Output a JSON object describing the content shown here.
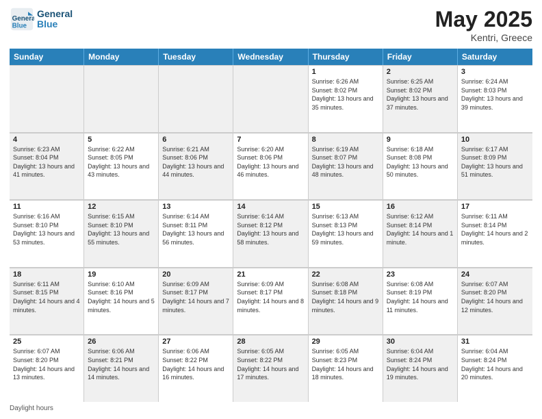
{
  "header": {
    "logo_general": "General",
    "logo_blue": "Blue",
    "month_title": "May 2025",
    "location": "Kentri, Greece"
  },
  "days_of_week": [
    "Sunday",
    "Monday",
    "Tuesday",
    "Wednesday",
    "Thursday",
    "Friday",
    "Saturday"
  ],
  "weeks": [
    [
      {
        "day": "",
        "info": "",
        "shaded": true
      },
      {
        "day": "",
        "info": "",
        "shaded": true
      },
      {
        "day": "",
        "info": "",
        "shaded": true
      },
      {
        "day": "",
        "info": "",
        "shaded": true
      },
      {
        "day": "1",
        "info": "Sunrise: 6:26 AM\nSunset: 8:02 PM\nDaylight: 13 hours and 35 minutes."
      },
      {
        "day": "2",
        "info": "Sunrise: 6:25 AM\nSunset: 8:02 PM\nDaylight: 13 hours and 37 minutes.",
        "shaded": true
      },
      {
        "day": "3",
        "info": "Sunrise: 6:24 AM\nSunset: 8:03 PM\nDaylight: 13 hours and 39 minutes."
      }
    ],
    [
      {
        "day": "4",
        "info": "Sunrise: 6:23 AM\nSunset: 8:04 PM\nDaylight: 13 hours and 41 minutes.",
        "shaded": true
      },
      {
        "day": "5",
        "info": "Sunrise: 6:22 AM\nSunset: 8:05 PM\nDaylight: 13 hours and 43 minutes."
      },
      {
        "day": "6",
        "info": "Sunrise: 6:21 AM\nSunset: 8:06 PM\nDaylight: 13 hours and 44 minutes.",
        "shaded": true
      },
      {
        "day": "7",
        "info": "Sunrise: 6:20 AM\nSunset: 8:06 PM\nDaylight: 13 hours and 46 minutes."
      },
      {
        "day": "8",
        "info": "Sunrise: 6:19 AM\nSunset: 8:07 PM\nDaylight: 13 hours and 48 minutes.",
        "shaded": true
      },
      {
        "day": "9",
        "info": "Sunrise: 6:18 AM\nSunset: 8:08 PM\nDaylight: 13 hours and 50 minutes."
      },
      {
        "day": "10",
        "info": "Sunrise: 6:17 AM\nSunset: 8:09 PM\nDaylight: 13 hours and 51 minutes.",
        "shaded": true
      }
    ],
    [
      {
        "day": "11",
        "info": "Sunrise: 6:16 AM\nSunset: 8:10 PM\nDaylight: 13 hours and 53 minutes."
      },
      {
        "day": "12",
        "info": "Sunrise: 6:15 AM\nSunset: 8:10 PM\nDaylight: 13 hours and 55 minutes.",
        "shaded": true
      },
      {
        "day": "13",
        "info": "Sunrise: 6:14 AM\nSunset: 8:11 PM\nDaylight: 13 hours and 56 minutes."
      },
      {
        "day": "14",
        "info": "Sunrise: 6:14 AM\nSunset: 8:12 PM\nDaylight: 13 hours and 58 minutes.",
        "shaded": true
      },
      {
        "day": "15",
        "info": "Sunrise: 6:13 AM\nSunset: 8:13 PM\nDaylight: 13 hours and 59 minutes."
      },
      {
        "day": "16",
        "info": "Sunrise: 6:12 AM\nSunset: 8:14 PM\nDaylight: 14 hours and 1 minute.",
        "shaded": true
      },
      {
        "day": "17",
        "info": "Sunrise: 6:11 AM\nSunset: 8:14 PM\nDaylight: 14 hours and 2 minutes."
      }
    ],
    [
      {
        "day": "18",
        "info": "Sunrise: 6:11 AM\nSunset: 8:15 PM\nDaylight: 14 hours and 4 minutes.",
        "shaded": true
      },
      {
        "day": "19",
        "info": "Sunrise: 6:10 AM\nSunset: 8:16 PM\nDaylight: 14 hours and 5 minutes."
      },
      {
        "day": "20",
        "info": "Sunrise: 6:09 AM\nSunset: 8:17 PM\nDaylight: 14 hours and 7 minutes.",
        "shaded": true
      },
      {
        "day": "21",
        "info": "Sunrise: 6:09 AM\nSunset: 8:17 PM\nDaylight: 14 hours and 8 minutes."
      },
      {
        "day": "22",
        "info": "Sunrise: 6:08 AM\nSunset: 8:18 PM\nDaylight: 14 hours and 9 minutes.",
        "shaded": true
      },
      {
        "day": "23",
        "info": "Sunrise: 6:08 AM\nSunset: 8:19 PM\nDaylight: 14 hours and 11 minutes."
      },
      {
        "day": "24",
        "info": "Sunrise: 6:07 AM\nSunset: 8:20 PM\nDaylight: 14 hours and 12 minutes.",
        "shaded": true
      }
    ],
    [
      {
        "day": "25",
        "info": "Sunrise: 6:07 AM\nSunset: 8:20 PM\nDaylight: 14 hours and 13 minutes."
      },
      {
        "day": "26",
        "info": "Sunrise: 6:06 AM\nSunset: 8:21 PM\nDaylight: 14 hours and 14 minutes.",
        "shaded": true
      },
      {
        "day": "27",
        "info": "Sunrise: 6:06 AM\nSunset: 8:22 PM\nDaylight: 14 hours and 16 minutes."
      },
      {
        "day": "28",
        "info": "Sunrise: 6:05 AM\nSunset: 8:22 PM\nDaylight: 14 hours and 17 minutes.",
        "shaded": true
      },
      {
        "day": "29",
        "info": "Sunrise: 6:05 AM\nSunset: 8:23 PM\nDaylight: 14 hours and 18 minutes."
      },
      {
        "day": "30",
        "info": "Sunrise: 6:04 AM\nSunset: 8:24 PM\nDaylight: 14 hours and 19 minutes.",
        "shaded": true
      },
      {
        "day": "31",
        "info": "Sunrise: 6:04 AM\nSunset: 8:24 PM\nDaylight: 14 hours and 20 minutes."
      }
    ]
  ],
  "footer": {
    "note": "Daylight hours"
  }
}
